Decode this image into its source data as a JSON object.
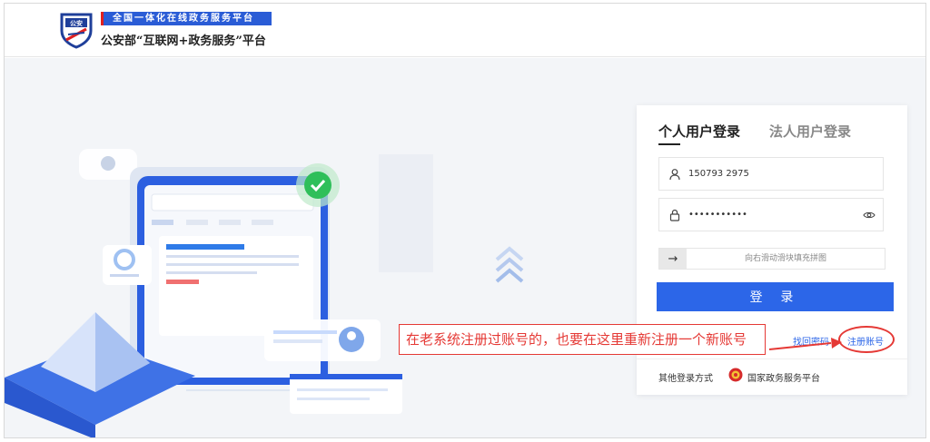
{
  "header": {
    "slogan": "全国一体化在线政务服务平台",
    "logo_text": "公安",
    "title": "公安部“互联网+政务服务”平台"
  },
  "login": {
    "tabs": [
      {
        "label": "个人用户登录",
        "active": true
      },
      {
        "label": "法人用户登录",
        "active": false
      }
    ],
    "username_value": "150793 2975",
    "password_value": "•••••••••••",
    "slider_hint": "向右滑动滑块填充拼图",
    "slider_handle_icon": "→",
    "submit_label": "登 录",
    "find_password": "找回密码",
    "register": "注册账号",
    "other_methods_label": "其他登录方式",
    "gov_platform_link": "国家政务服务平台"
  },
  "annotation": {
    "text": "在老系统注册过账号的，也要在这里重新注册一个新账号",
    "color": "#e53935"
  },
  "colors": {
    "primary": "#2c66e8",
    "slogan_bg": "#2a5cd6",
    "annotation": "#e53935"
  }
}
